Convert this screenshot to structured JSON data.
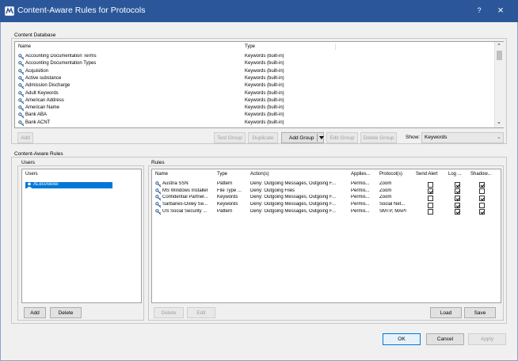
{
  "window": {
    "title": "Content-Aware Rules for Protocols",
    "help_label": "?",
    "close_label": "×"
  },
  "content_database": {
    "section_label": "Content Database",
    "columns": {
      "name": "Name",
      "type": "Type"
    },
    "rows": [
      {
        "name": "Accounting Documentation Terms",
        "type": "Keywords (built-in)"
      },
      {
        "name": "Accounting Documentation Types",
        "type": "Keywords (built-in)"
      },
      {
        "name": "Acquisition",
        "type": "Keywords (built-in)"
      },
      {
        "name": "Active substance",
        "type": "Keywords (built-in)"
      },
      {
        "name": "Admission Discharge",
        "type": "Keywords (built-in)"
      },
      {
        "name": "Adult Keywords",
        "type": "Keywords (built-in)"
      },
      {
        "name": "American Address",
        "type": "Keywords (built-in)"
      },
      {
        "name": "American Name",
        "type": "Keywords (built-in)"
      },
      {
        "name": "Bank ABA",
        "type": "Keywords (built-in)"
      },
      {
        "name": "Bank ACNT",
        "type": "Keywords (built-in)"
      }
    ],
    "buttons": {
      "add": "Add",
      "test_group": "Test Group",
      "duplicate": "Duplicate",
      "add_group": "Add Group",
      "edit_group": "Edit Group",
      "delete_group": "Delete Group"
    },
    "show_label": "Show:",
    "show_value": "Keywords"
  },
  "content_aware_rules": {
    "section_label": "Content-Aware Rules",
    "users": {
      "group_label": "Users",
      "column": "Users",
      "items": [
        {
          "name": "ALes\\Alexei"
        }
      ],
      "buttons": {
        "add": "Add",
        "delete": "Delete"
      }
    },
    "rules": {
      "group_label": "Rules",
      "columns": {
        "name": "Name",
        "type": "Type",
        "actions": "Action(s)",
        "applies": "Applies...",
        "protocols": "Protocol(s)",
        "send_alert": "Send Alert",
        "log": "Log ...",
        "shadow": "Shadow..."
      },
      "rows": [
        {
          "name": "Austria SSN",
          "type": "Pattern",
          "actions": "Deny: Outgoing Messages, Outgoing F...",
          "applies": "Permis...",
          "protocols": "Zoom",
          "send_alert": false,
          "log": true,
          "shadow": true
        },
        {
          "name": "MS Windows Installer",
          "type": "File Type ...",
          "actions": "Deny: Outgoing Files",
          "applies": "Permis...",
          "protocols": "Zoom",
          "send_alert": true,
          "log": true,
          "shadow": false
        },
        {
          "name": "Confidential Partner...",
          "type": "Keywords",
          "actions": "Deny: Outgoing Messages, Outgoing F...",
          "applies": "Permis...",
          "protocols": "Zoom",
          "send_alert": false,
          "log": true,
          "shadow": true
        },
        {
          "name": "Sarbanes-Oxley Se...",
          "type": "Keywords",
          "actions": "Deny: Outgoing Messages, Outgoing F...",
          "applies": "Permis...",
          "protocols": "Social Net...",
          "send_alert": false,
          "log": true,
          "shadow": false
        },
        {
          "name": "US Social Security ...",
          "type": "Pattern",
          "actions": "Deny: Outgoing Messages, Outgoing F...",
          "applies": "Permis...",
          "protocols": "SMTP, MAPI",
          "send_alert": false,
          "log": true,
          "shadow": true
        }
      ],
      "buttons": {
        "delete": "Delete",
        "edit": "Edit",
        "load": "Load",
        "save": "Save"
      }
    }
  },
  "footer": {
    "ok": "OK",
    "cancel": "Cancel",
    "apply": "Apply"
  },
  "colors": {
    "titlebar": "#2b579a",
    "selection": "#0078d7",
    "accent": "#0078d7"
  }
}
